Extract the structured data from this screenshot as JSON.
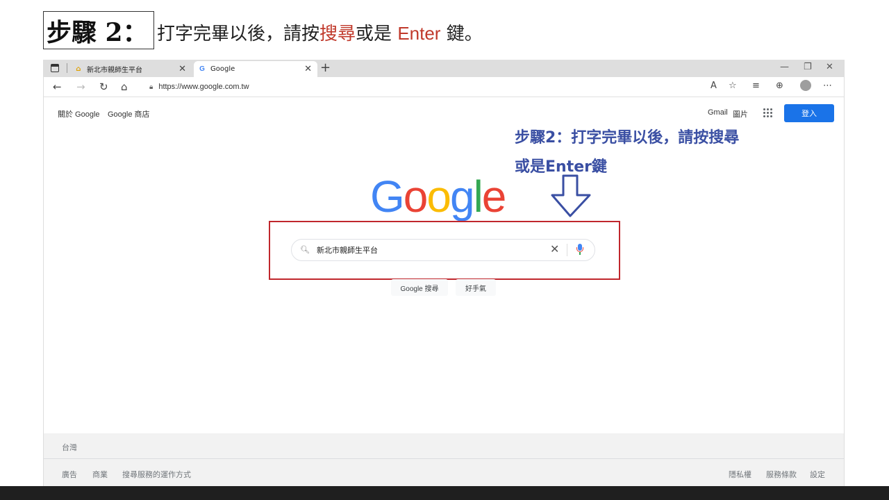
{
  "slide": {
    "step_label": "步驟 2：",
    "instruction_prefix": "打字完畢以後，請按",
    "instruction_highlight": "搜尋",
    "instruction_mid": "或是",
    "instruction_enter": "Enter",
    "instruction_suffix": "鍵。"
  },
  "browser": {
    "tabs": [
      {
        "label": "新北市親師生平台",
        "icon": "home-icon"
      },
      {
        "label": "Google",
        "icon": "google-icon"
      }
    ],
    "url": "https://www.google.com.tw"
  },
  "google": {
    "top_left_links": [
      "關於 Google",
      "Google 商店"
    ],
    "top_right_links": [
      "Gmail",
      "圖片"
    ],
    "signin_label": "登入",
    "logo_text": [
      "G",
      "o",
      "o",
      "g",
      "l",
      "e"
    ],
    "search_value": "新北市親師生平台",
    "buttons": [
      "Google 搜尋",
      "好手氣"
    ],
    "footer_region": "台灣",
    "footer_left_links": [
      "廣告",
      "商業",
      "搜尋服務的運作方式"
    ],
    "footer_right_links": [
      "隱私權",
      "服務條款",
      "設定"
    ]
  },
  "annotation": {
    "line1": "步驟2：打字完畢以後，請按搜尋",
    "line2": "或是Enter鍵"
  },
  "colors": {
    "annotation": "#3a4fa3",
    "highlight_frame": "#c0262c",
    "signin_button": "#1a73e8"
  }
}
